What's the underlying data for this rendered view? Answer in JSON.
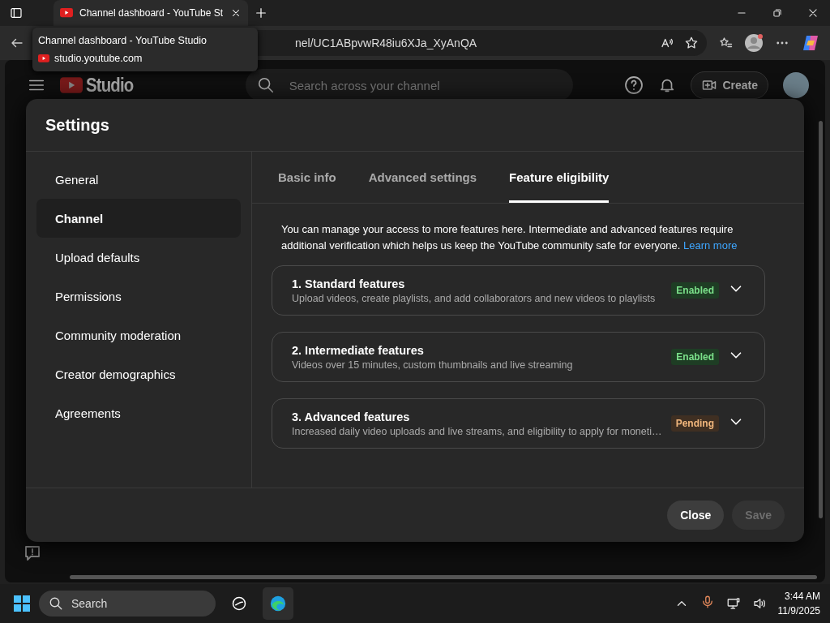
{
  "browser": {
    "tab_title": "Channel dashboard - YouTube St",
    "address": "nel/UC1ABpvwR48iu6XJa_XyAnQA",
    "tooltip": {
      "title": "Channel dashboard - YouTube Studio",
      "url": "studio.youtube.com"
    }
  },
  "studio_header": {
    "logo": "Studio",
    "search": {
      "placeholder": "Search across your channel"
    },
    "create_button": "Create"
  },
  "settings_dialog": {
    "title": "Settings",
    "sidebar": {
      "items": [
        {
          "label": "General",
          "selected": false
        },
        {
          "label": "Channel",
          "selected": true
        },
        {
          "label": "Upload defaults",
          "selected": false
        },
        {
          "label": "Permissions",
          "selected": false
        },
        {
          "label": "Community moderation",
          "selected": false
        },
        {
          "label": "Creator demographics",
          "selected": false
        },
        {
          "label": "Agreements",
          "selected": false
        }
      ]
    },
    "tabs": [
      {
        "label": "Basic info",
        "selected": false
      },
      {
        "label": "Advanced settings",
        "selected": false
      },
      {
        "label": "Feature eligibility",
        "selected": true
      }
    ],
    "intro": "You can manage your access to more features here. Intermediate and advanced features require additional verification which helps us keep the YouTube community safe for everyone.",
    "learn_more": "Learn more",
    "features": [
      {
        "title": "1. Standard features",
        "description": "Upload videos, create playlists, and add collaborators and new videos to playlists",
        "status": "Enabled",
        "kind": "enabled"
      },
      {
        "title": "2. Intermediate features",
        "description": "Videos over 15 minutes, custom thumbnails and live streaming",
        "status": "Enabled",
        "kind": "enabled"
      },
      {
        "title": "3. Advanced features",
        "description": "Increased daily video uploads and live streams, and eligibility to apply for moneti…",
        "status": "Pending",
        "kind": "pending"
      }
    ],
    "buttons": [
      {
        "label": "Close",
        "disabled": false
      },
      {
        "label": "Save",
        "disabled": true
      }
    ]
  },
  "taskbar": {
    "search_label": "Search",
    "time": "3:44 AM",
    "date": "11/9/2025"
  }
}
